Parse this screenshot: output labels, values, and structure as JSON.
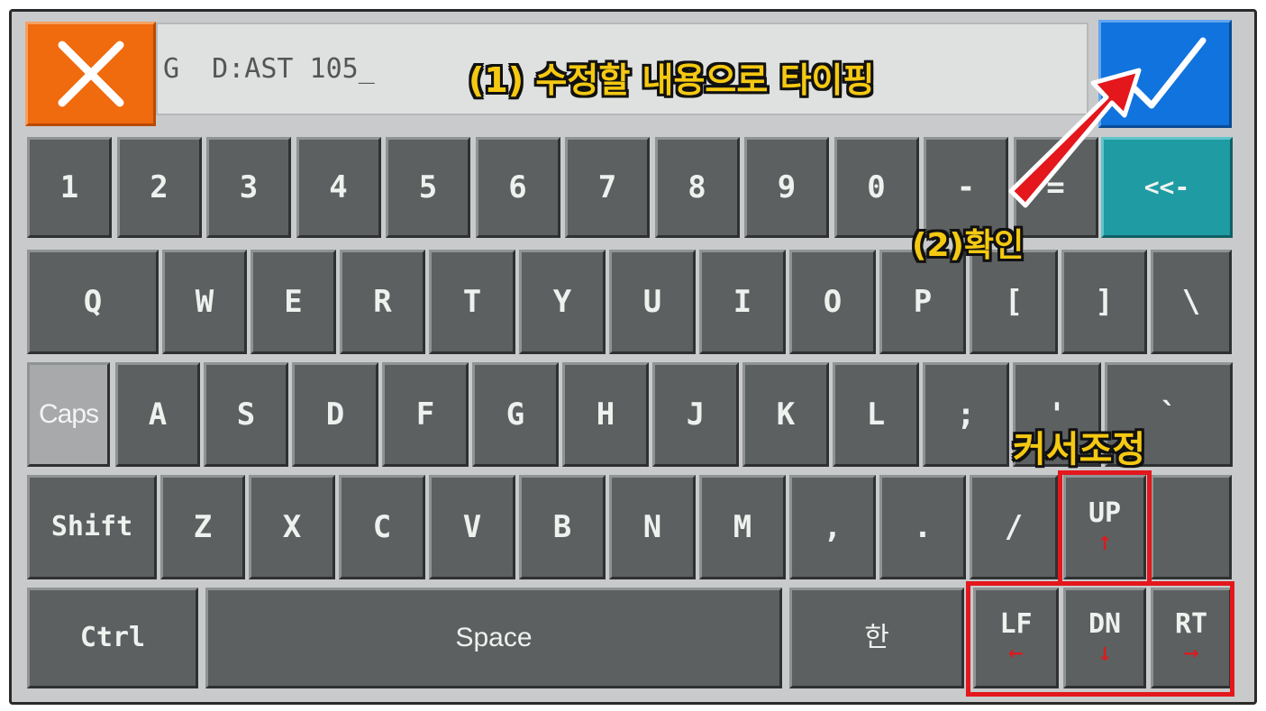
{
  "input": {
    "value": "G  D:AST 105_"
  },
  "buttons": {
    "cancel_icon": "close-icon",
    "confirm_icon": "checkmark-icon",
    "backspace_label": "<<-"
  },
  "keys": {
    "row1": [
      "1",
      "2",
      "3",
      "4",
      "5",
      "6",
      "7",
      "8",
      "9",
      "0",
      "-",
      "="
    ],
    "row2": [
      "Q",
      "W",
      "E",
      "R",
      "T",
      "Y",
      "U",
      "I",
      "O",
      "P",
      "[",
      "]",
      "\\"
    ],
    "row3": [
      "Caps",
      "A",
      "S",
      "D",
      "F",
      "G",
      "H",
      "J",
      "K",
      "L",
      ";",
      "'",
      "`"
    ],
    "row4": [
      "Shift",
      "Z",
      "X",
      "C",
      "V",
      "B",
      "N",
      "M",
      ",",
      ".",
      "/",
      "UP",
      ""
    ],
    "row5": [
      "Ctrl",
      "Space",
      "한",
      "LF",
      "DN",
      "RT"
    ]
  },
  "arrows": {
    "up": "↑",
    "left": "←",
    "down": "↓",
    "right": "→"
  },
  "annotations": {
    "step1": "(1) 수정할 내용으로 타이핑",
    "step2": "(2)확인",
    "cursor": "커서조정"
  },
  "colors": {
    "cancel": "#f06a0e",
    "confirm": "#1173dd",
    "backspace": "#1e9ba3",
    "highlight": "#e3171c",
    "annotation": "#f5c912"
  }
}
